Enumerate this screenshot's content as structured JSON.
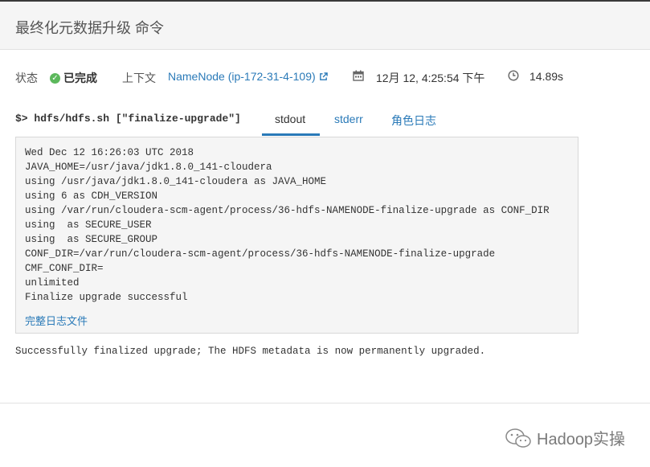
{
  "header": {
    "title": "最终化元数据升级 命令"
  },
  "meta": {
    "status_label": "状态",
    "status_value": "已完成",
    "context_label": "上下文",
    "context_link": "NameNode (ip-172-31-4-109)",
    "date": "12月 12, 4:25:54 下午",
    "duration": "14.89s"
  },
  "command": "$> hdfs/hdfs.sh [\"finalize-upgrade\"]",
  "tabs": [
    "stdout",
    "stderr",
    "角色日志"
  ],
  "output": {
    "lines": [
      "Wed Dec 12 16:26:03 UTC 2018",
      "JAVA_HOME=/usr/java/jdk1.8.0_141-cloudera",
      "using /usr/java/jdk1.8.0_141-cloudera as JAVA_HOME",
      "using 6 as CDH_VERSION",
      "using /var/run/cloudera-scm-agent/process/36-hdfs-NAMENODE-finalize-upgrade as CONF_DIR",
      "using  as SECURE_USER",
      "using  as SECURE_GROUP",
      "CONF_DIR=/var/run/cloudera-scm-agent/process/36-hdfs-NAMENODE-finalize-upgrade",
      "CMF_CONF_DIR=",
      "unlimited",
      "Finalize upgrade successful"
    ],
    "full_log_link": "完整日志文件"
  },
  "result_message": "Successfully finalized upgrade; The HDFS metadata is now permanently upgraded.",
  "watermark": {
    "text": "Hadoop实操"
  },
  "colors": {
    "accent": "#2a7ab8",
    "success": "#5cb85c"
  }
}
